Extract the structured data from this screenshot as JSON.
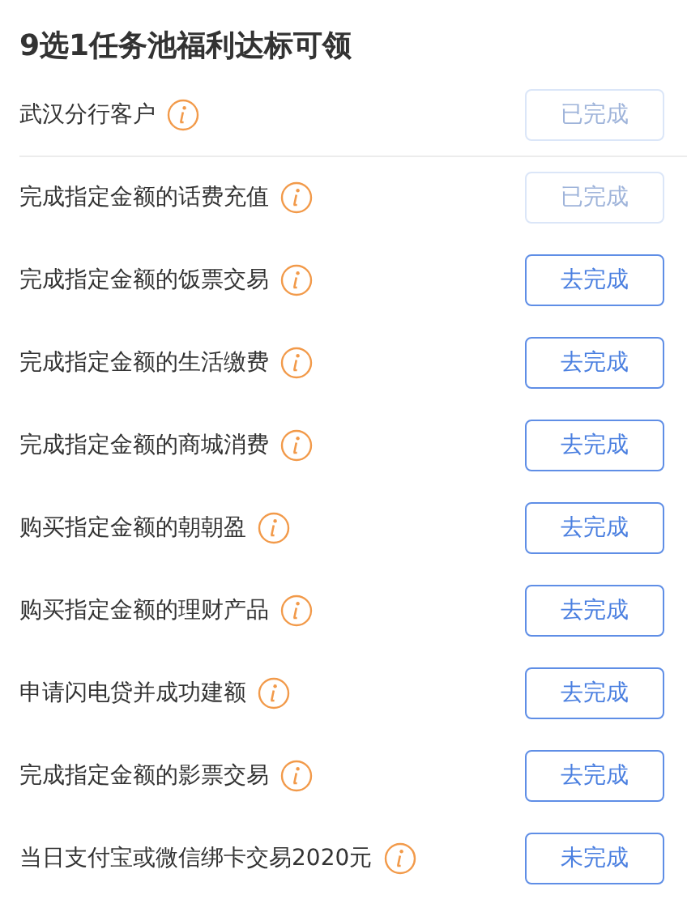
{
  "title": "9选1任务池福利达标可领",
  "tasks": [
    {
      "label": "武汉分行客户",
      "button": "已完成",
      "disabled": true,
      "divider": true
    },
    {
      "label": "完成指定金额的话费充值",
      "button": "已完成",
      "disabled": true,
      "divider": false
    },
    {
      "label": "完成指定金额的饭票交易",
      "button": "去完成",
      "disabled": false,
      "divider": false
    },
    {
      "label": "完成指定金额的生活缴费",
      "button": "去完成",
      "disabled": false,
      "divider": false
    },
    {
      "label": "完成指定金额的商城消费",
      "button": "去完成",
      "disabled": false,
      "divider": false
    },
    {
      "label": "购买指定金额的朝朝盈",
      "button": "去完成",
      "disabled": false,
      "divider": false
    },
    {
      "label": "购买指定金额的理财产品",
      "button": "去完成",
      "disabled": false,
      "divider": false
    },
    {
      "label": "申请闪电贷并成功建额",
      "button": "去完成",
      "disabled": false,
      "divider": false
    },
    {
      "label": "完成指定金额的影票交易",
      "button": "去完成",
      "disabled": false,
      "divider": false
    },
    {
      "label": "当日支付宝或微信绑卡交易2020元",
      "button": "未完成",
      "disabled": false,
      "divider": false
    }
  ]
}
